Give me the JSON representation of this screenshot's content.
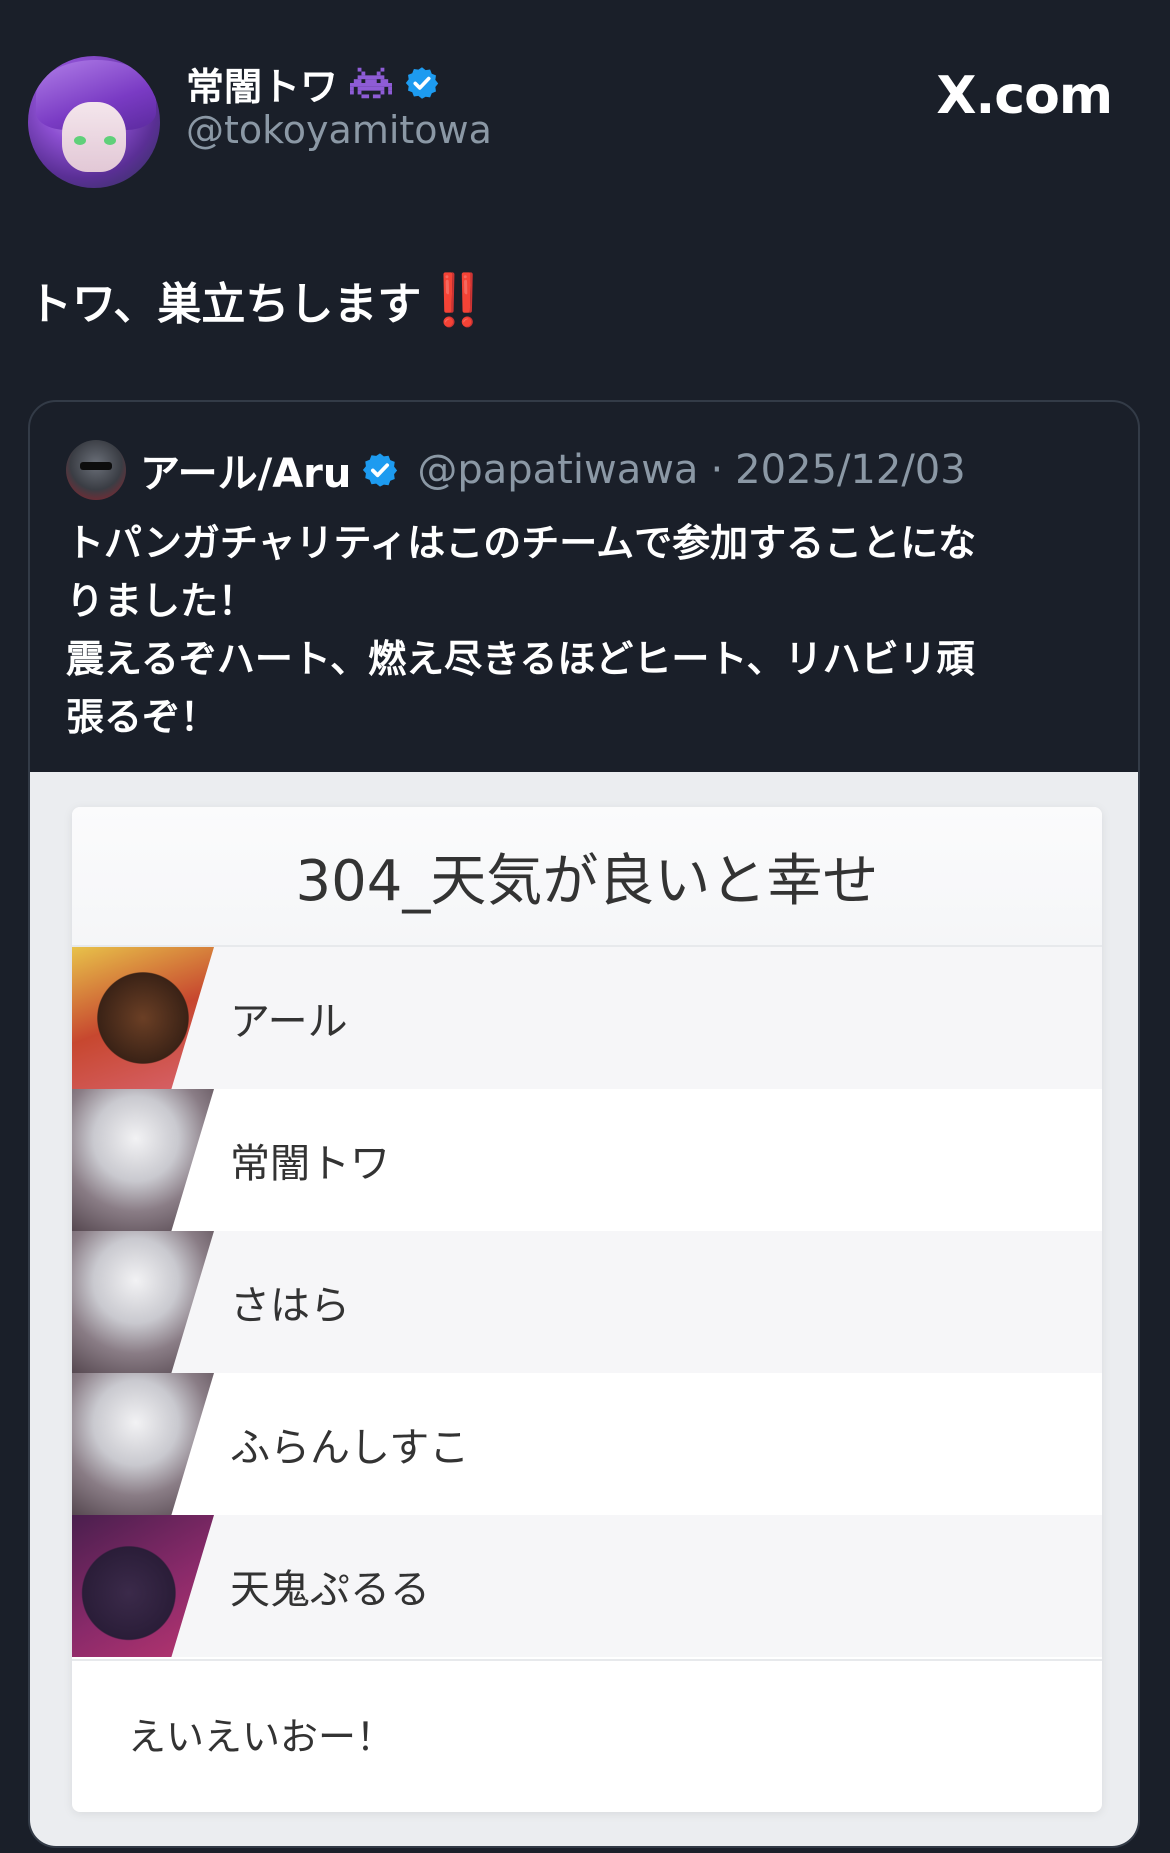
{
  "post": {
    "author_name": "常闇トワ",
    "author_handle": "@tokoyamitowa",
    "source_label": "X.com",
    "text": "トワ、巣立ちします",
    "text_emoji": "‼️",
    "icons": [
      "alien-monster-icon",
      "verified-badge-icon"
    ]
  },
  "quote": {
    "author_name": "アール/Aru",
    "author_handle": "@papatiwawa",
    "separator": "·",
    "date": "2025/12/03",
    "text_lines": [
      "トパンガチャリティはこのチームで参加することにな",
      "りました！",
      "震えるぞハート、燃え尽きるほどヒート、リハビリ頑",
      "張るぞ！"
    ]
  },
  "team": {
    "title": "304_天気が良いと幸せ",
    "members": [
      {
        "name": "アール",
        "portrait": "character-portrait-dark-hair"
      },
      {
        "name": "常闇トワ",
        "portrait": "character-portrait-white-hair"
      },
      {
        "name": "さはら",
        "portrait": "character-portrait-white-hair"
      },
      {
        "name": "ふらんしすこ",
        "portrait": "character-portrait-white-hair"
      },
      {
        "name": "天鬼ぷるる",
        "portrait": "character-portrait-purple"
      }
    ],
    "footer": "えいえいおー！"
  },
  "colors": {
    "background": "#1a1f29",
    "verified_blue": "#1d9bf0",
    "handle_gray": "#8b98a5",
    "exclamation_red": "#e8262e"
  }
}
